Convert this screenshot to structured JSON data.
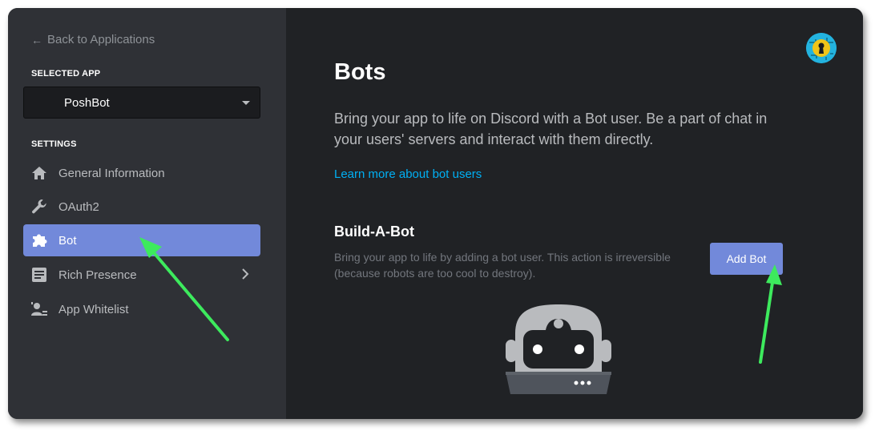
{
  "sidebar": {
    "back_label": "Back to Applications",
    "selected_app_label": "SELECTED APP",
    "selected_app_value": "PoshBot",
    "settings_label": "SETTINGS",
    "items": [
      {
        "label": "General Information",
        "icon": "home-icon"
      },
      {
        "label": "OAuth2",
        "icon": "wrench-icon"
      },
      {
        "label": "Bot",
        "icon": "puzzle-icon",
        "active": true
      },
      {
        "label": "Rich Presence",
        "icon": "document-icon",
        "has_submenu": true
      },
      {
        "label": "App Whitelist",
        "icon": "user-list-icon"
      }
    ]
  },
  "main": {
    "title": "Bots",
    "description": "Bring your app to life on Discord with a Bot user. Be a part of chat in your users' servers and interact with them directly.",
    "learn_more": "Learn more about bot users",
    "build_title": "Build-A-Bot",
    "build_description": "Bring your app to life by adding a bot user. This action is irreversible (because robots are too cool to destroy).",
    "add_bot_label": "Add Bot"
  },
  "colors": {
    "accent": "#7289da",
    "link": "#00b0f4",
    "sidebar_bg": "#2f3136",
    "main_bg": "#202225",
    "annotation_arrow": "#3dea5d"
  }
}
